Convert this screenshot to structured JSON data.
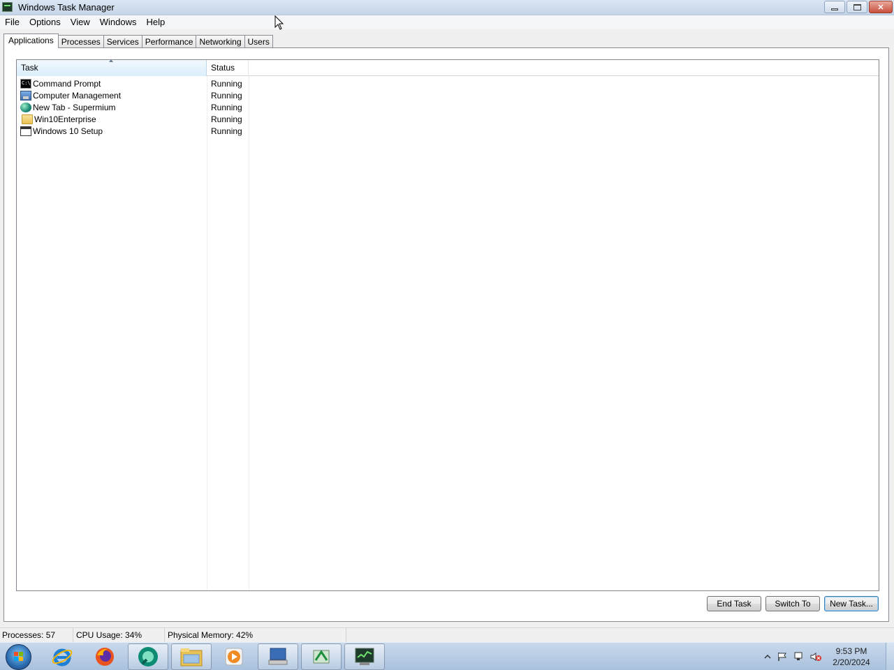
{
  "window": {
    "title": "Windows Task Manager"
  },
  "menu": [
    "File",
    "Options",
    "View",
    "Windows",
    "Help"
  ],
  "tabs": [
    "Applications",
    "Processes",
    "Services",
    "Performance",
    "Networking",
    "Users"
  ],
  "active_tab": "Applications",
  "list": {
    "columns": {
      "task": "Task",
      "status": "Status"
    },
    "rows": [
      {
        "task": "Command Prompt",
        "status": "Running",
        "icon": "command-prompt-icon"
      },
      {
        "task": "Computer Management",
        "status": "Running",
        "icon": "computer-management-icon"
      },
      {
        "task": "New Tab - Supermium",
        "status": "Running",
        "icon": "supermium-icon"
      },
      {
        "task": "Win10Enterprise",
        "status": "Running",
        "icon": "folder-icon"
      },
      {
        "task": "Windows 10 Setup",
        "status": "Running",
        "icon": "window-icon"
      }
    ]
  },
  "buttons": {
    "end_task": "End Task",
    "switch_to": "Switch To",
    "new_task": "New Task..."
  },
  "statusbar": {
    "processes": "Processes: 57",
    "cpu": "CPU Usage: 34%",
    "memory": "Physical Memory: 42%"
  },
  "taskbar": {
    "pinned": [
      "internet-explorer-icon",
      "firefox-icon",
      "supermium-icon",
      "file-explorer-icon",
      "media-player-icon",
      "remote-desktop-icon",
      "network-icon",
      "task-manager-icon"
    ],
    "time": "9:53 PM",
    "date": "2/20/2024"
  },
  "colors": {
    "selected_header": "#dbeefb",
    "default_button_border": "#3c7fb1",
    "taskbar": "#b9cde4"
  }
}
